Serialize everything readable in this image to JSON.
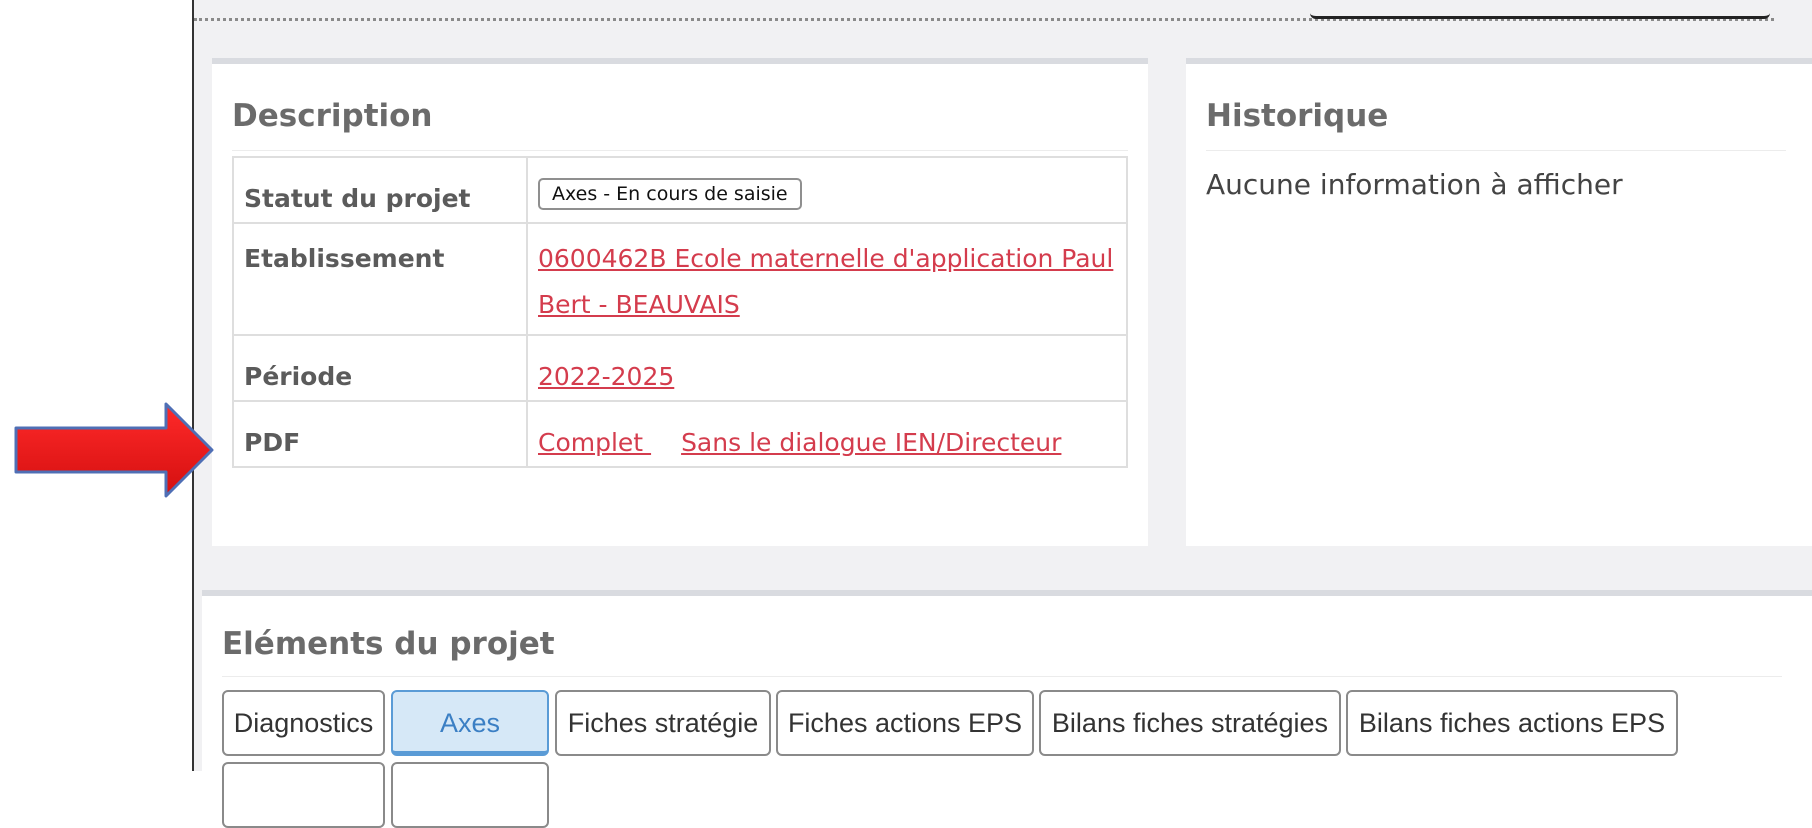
{
  "description": {
    "title": "Description",
    "rows": {
      "statut": {
        "label": "Statut du projet",
        "value": "Axes - En cours de saisie"
      },
      "etablissement": {
        "label": "Etablissement",
        "value": "0600462B Ecole maternelle d'application Paul Bert - BEAUVAIS"
      },
      "periode": {
        "label": "Période",
        "value": "2022-2025"
      },
      "pdf": {
        "label": "PDF",
        "link_complet": "Complet ",
        "link_sans": "Sans le dialogue IEN/Directeur"
      }
    }
  },
  "historique": {
    "title": "Historique",
    "empty_text": "Aucune information à afficher"
  },
  "elements": {
    "title": "Eléments du projet",
    "tabs": [
      "Diagnostics",
      "Axes",
      "Fiches stratégie",
      "Fiches actions EPS",
      "Bilans fiches stratégies",
      "Bilans fiches actions EPS"
    ],
    "active_tab": "Axes"
  },
  "colors": {
    "link": "#d43c4d",
    "arrow": "#e31313",
    "active_tab_bg": "#d6e8f7",
    "active_tab_text": "#3b7fc4"
  }
}
